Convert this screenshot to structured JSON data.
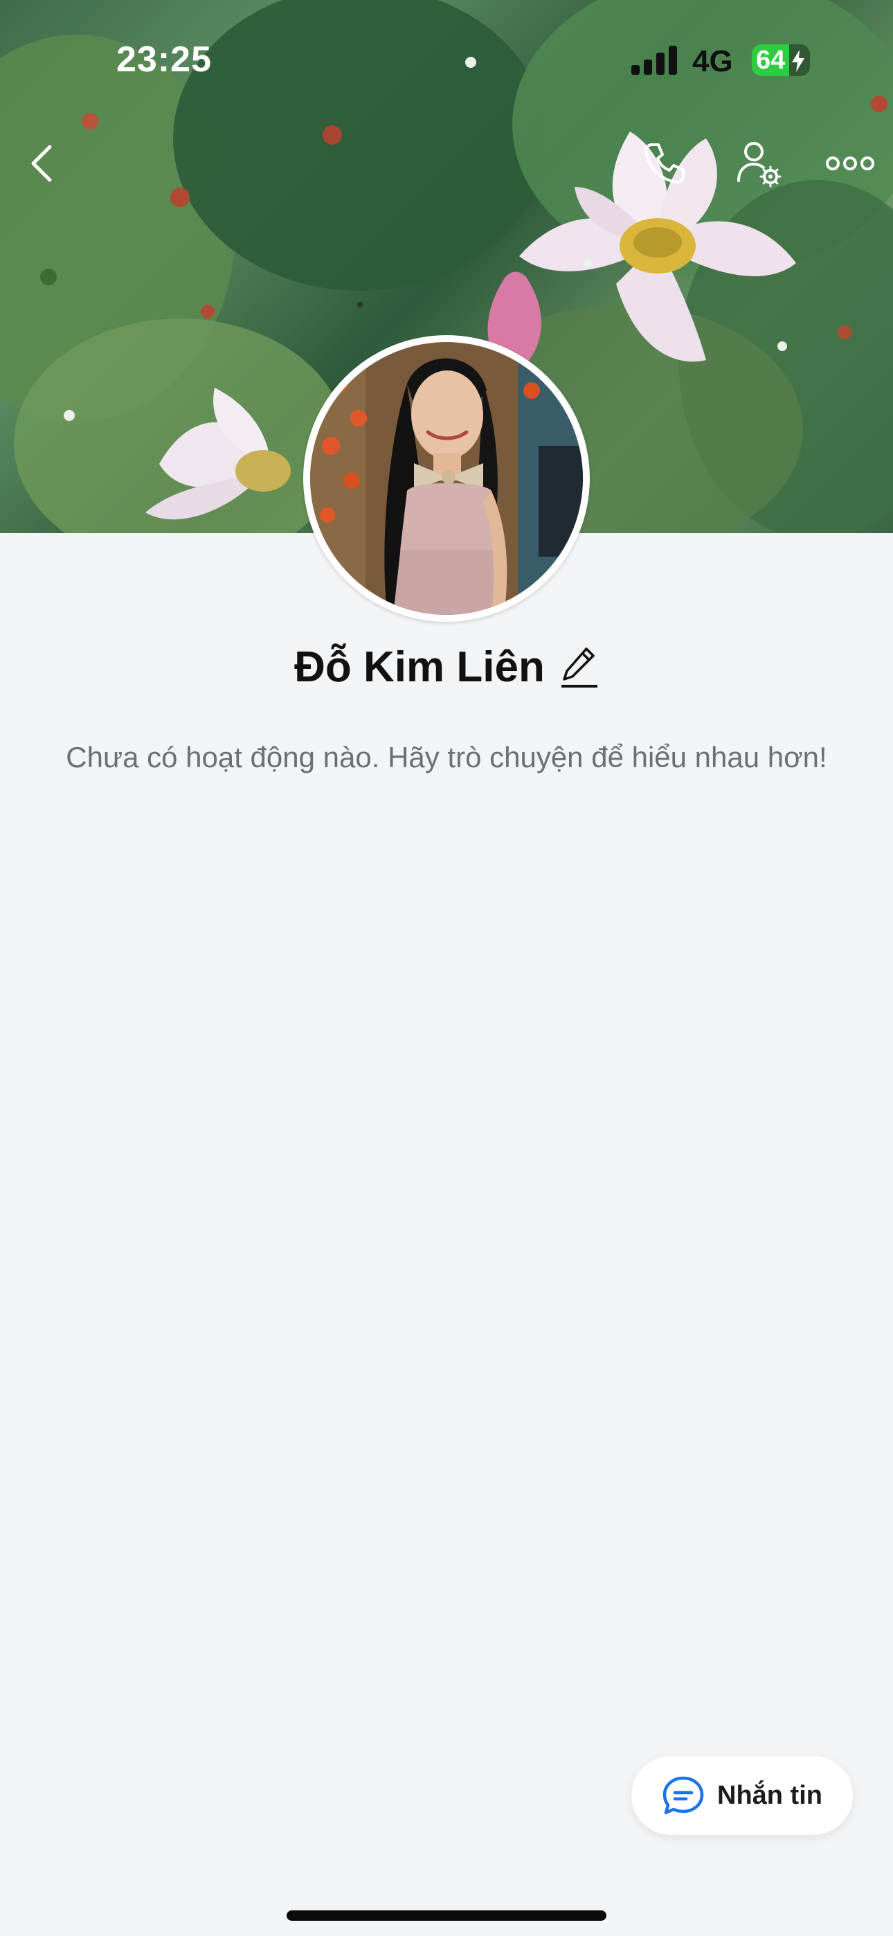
{
  "status_bar": {
    "time": "23:25",
    "network": "4G",
    "battery_percent": "64",
    "battery_level": 0.64,
    "signal_icon": "cellular-signal-icon",
    "battery_icon": "charging-battery-icon"
  },
  "nav": {
    "back_icon": "chevron-left-icon",
    "call_icon": "phone-icon",
    "friend_settings_icon": "user-gear-icon",
    "more_icon": "more-dots-icon"
  },
  "profile": {
    "name": "Đỗ Kim Liên",
    "edit_icon": "pencil-icon",
    "empty_message": "Chưa có hoạt động nào. Hãy trò chuyện để hiểu nhau hơn!"
  },
  "actions": {
    "message_label": "Nhắn tin",
    "message_icon": "chat-bubble-icon"
  },
  "colors": {
    "accent": "#1a73e8",
    "battery_fill": "#2ecc40",
    "background": "#f3f4f6"
  }
}
